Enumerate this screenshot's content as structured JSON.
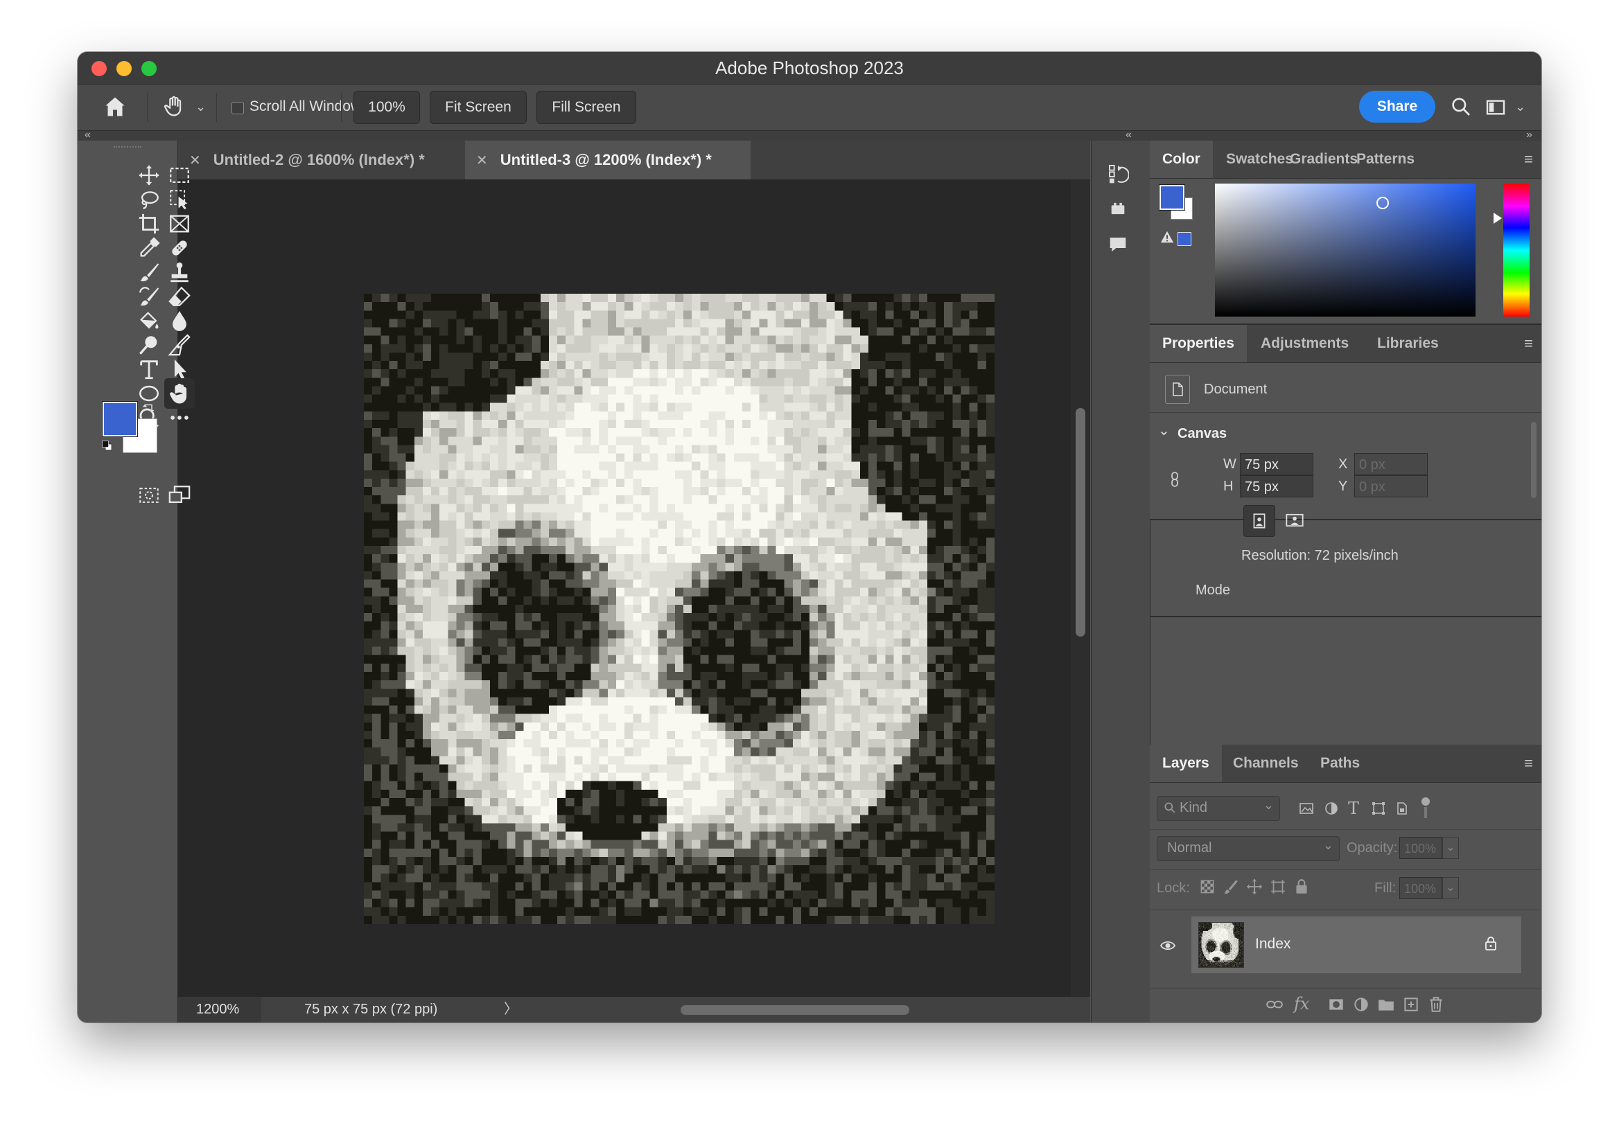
{
  "window": {
    "title": "Adobe Photoshop 2023"
  },
  "options_bar": {
    "scroll_all_windows": "Scroll All Windows",
    "zoom_value": "100%",
    "fit_screen": "Fit Screen",
    "fill_screen": "Fill Screen",
    "share": "Share"
  },
  "tabs": [
    {
      "label": "Untitled-2 @ 1600% (Index*) *"
    },
    {
      "label": "Untitled-3 @ 1200% (Index*) *"
    }
  ],
  "status_bar": {
    "zoom": "1200%",
    "doc_info": "75 px x 75 px (72 ppi)",
    "arrow": "〉"
  },
  "colors": {
    "foreground": "#3b63d0",
    "background": "#ffffff",
    "accent": "#2680eb"
  },
  "color_panel": {
    "tabs": [
      "Color",
      "Swatches",
      "Gradients",
      "Patterns"
    ]
  },
  "properties_panel": {
    "tabs": [
      "Properties",
      "Adjustments",
      "Libraries"
    ],
    "doc_type": "Document",
    "section": "Canvas",
    "w_label": "W",
    "w_value": "75 px",
    "h_label": "H",
    "h_value": "75 px",
    "x_label": "X",
    "x_placeholder": "0 px",
    "y_label": "Y",
    "y_placeholder": "0 px",
    "resolution": "Resolution: 72 pixels/inch",
    "mode": "Mode"
  },
  "layers_panel": {
    "tabs": [
      "Layers",
      "Channels",
      "Paths"
    ],
    "filter_kind": "Kind",
    "blend_mode": "Normal",
    "opacity_label": "Opacity:",
    "opacity_value": "100%",
    "lock_label": "Lock:",
    "fill_label": "Fill:",
    "fill_value": "100%",
    "layers": [
      {
        "name": "Index",
        "visible": true,
        "locked": true
      }
    ]
  }
}
